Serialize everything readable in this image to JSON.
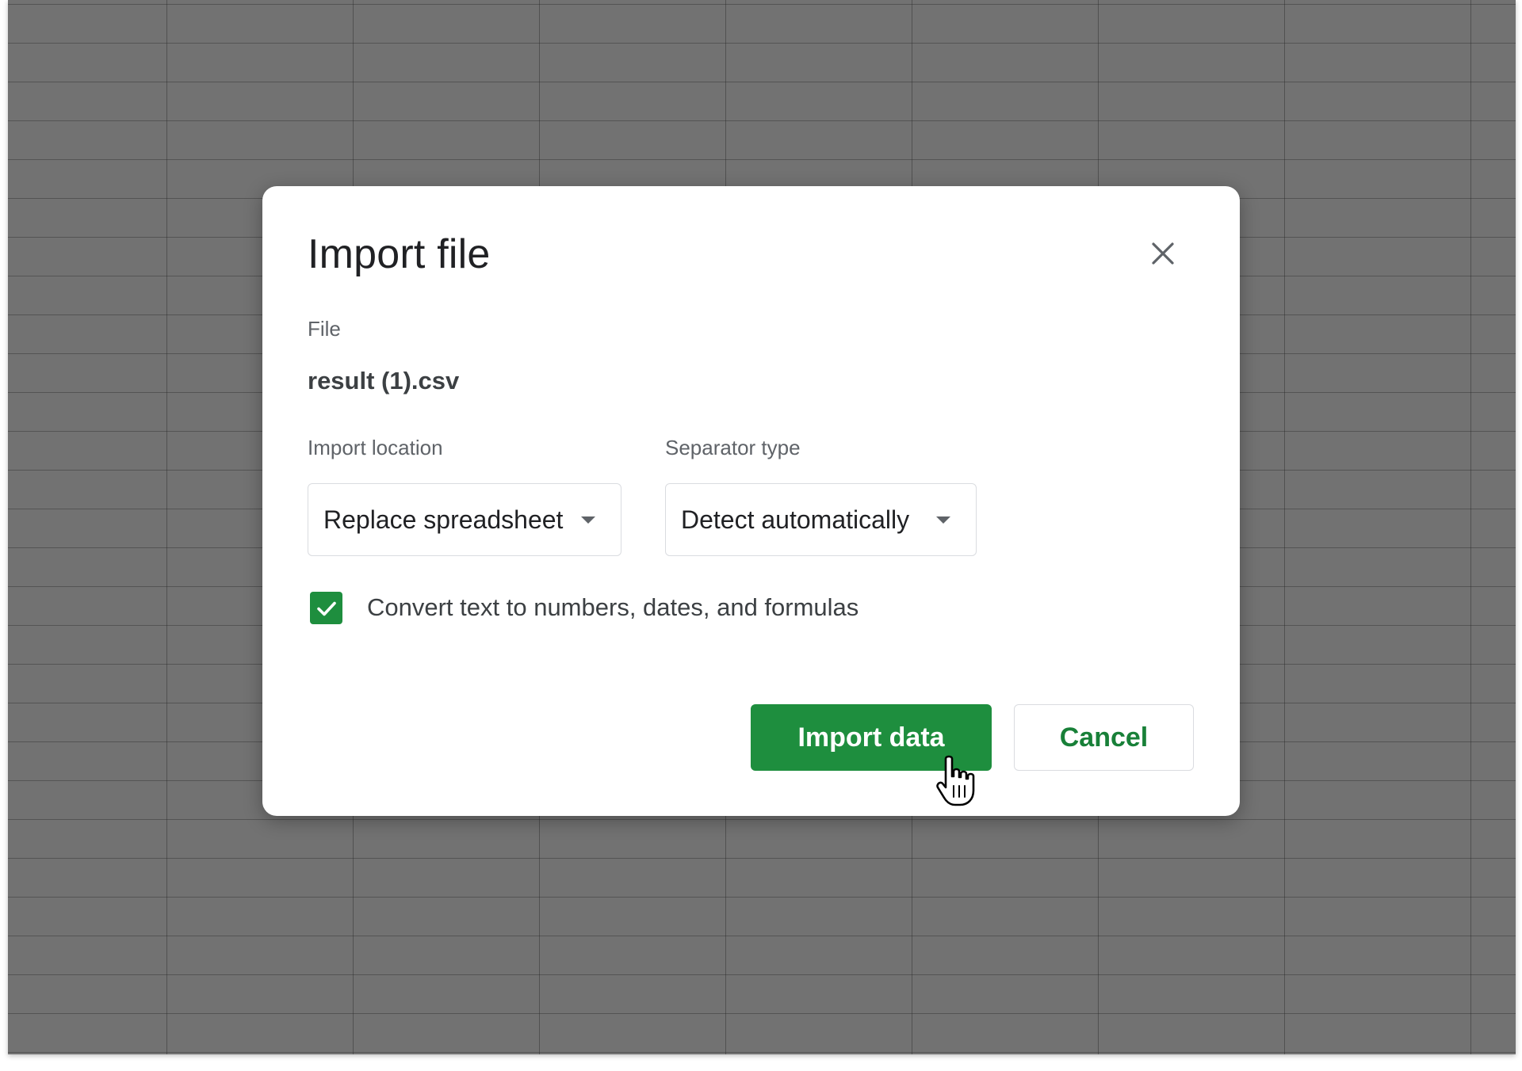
{
  "dialog": {
    "title": "Import file",
    "file_label": "File",
    "file_name": "result (1).csv",
    "import_location_label": "Import location",
    "import_location_value": "Replace spreadsheet",
    "separator_label": "Separator type",
    "separator_value": "Detect automatically",
    "convert_label": "Convert text to numbers, dates, and formulas",
    "convert_checked": true,
    "import_button": "Import data",
    "cancel_button": "Cancel"
  },
  "icons": {
    "close": "close-icon",
    "dropdown": "caret-down-icon",
    "check": "checkmark-icon",
    "cursor": "hand-pointer-icon"
  },
  "colors": {
    "accent": "#1e8e3e",
    "backdrop": "#727272",
    "text_primary": "#202124",
    "text_secondary": "#5f6368"
  }
}
